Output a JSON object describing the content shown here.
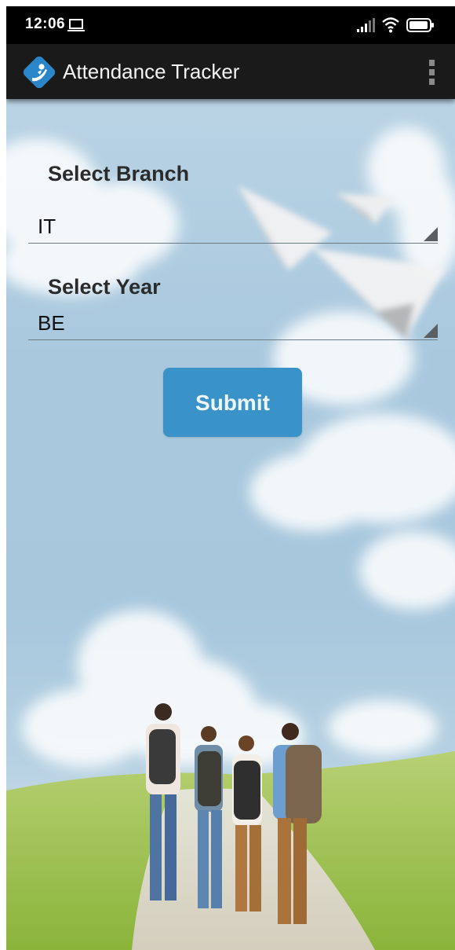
{
  "status_bar": {
    "time": "12:06",
    "icons": [
      "laptop-icon",
      "signal-icon",
      "wifi-icon",
      "battery-icon"
    ]
  },
  "app_bar": {
    "title": "Attendance Tracker",
    "logo_icon": "raised-hand-logo-icon",
    "menu_icon": "overflow-menu-icon",
    "background_color": "#1a1a1a"
  },
  "form": {
    "branch_label": "Select Branch",
    "branch_value": "IT",
    "year_label": "Select Year",
    "year_value": "BE",
    "submit_label": "Submit",
    "submit_color": "#3a93c8"
  },
  "colors": {
    "sky": "#a9c8de",
    "grass": "#a8c756",
    "logo": "#2b86c9"
  }
}
